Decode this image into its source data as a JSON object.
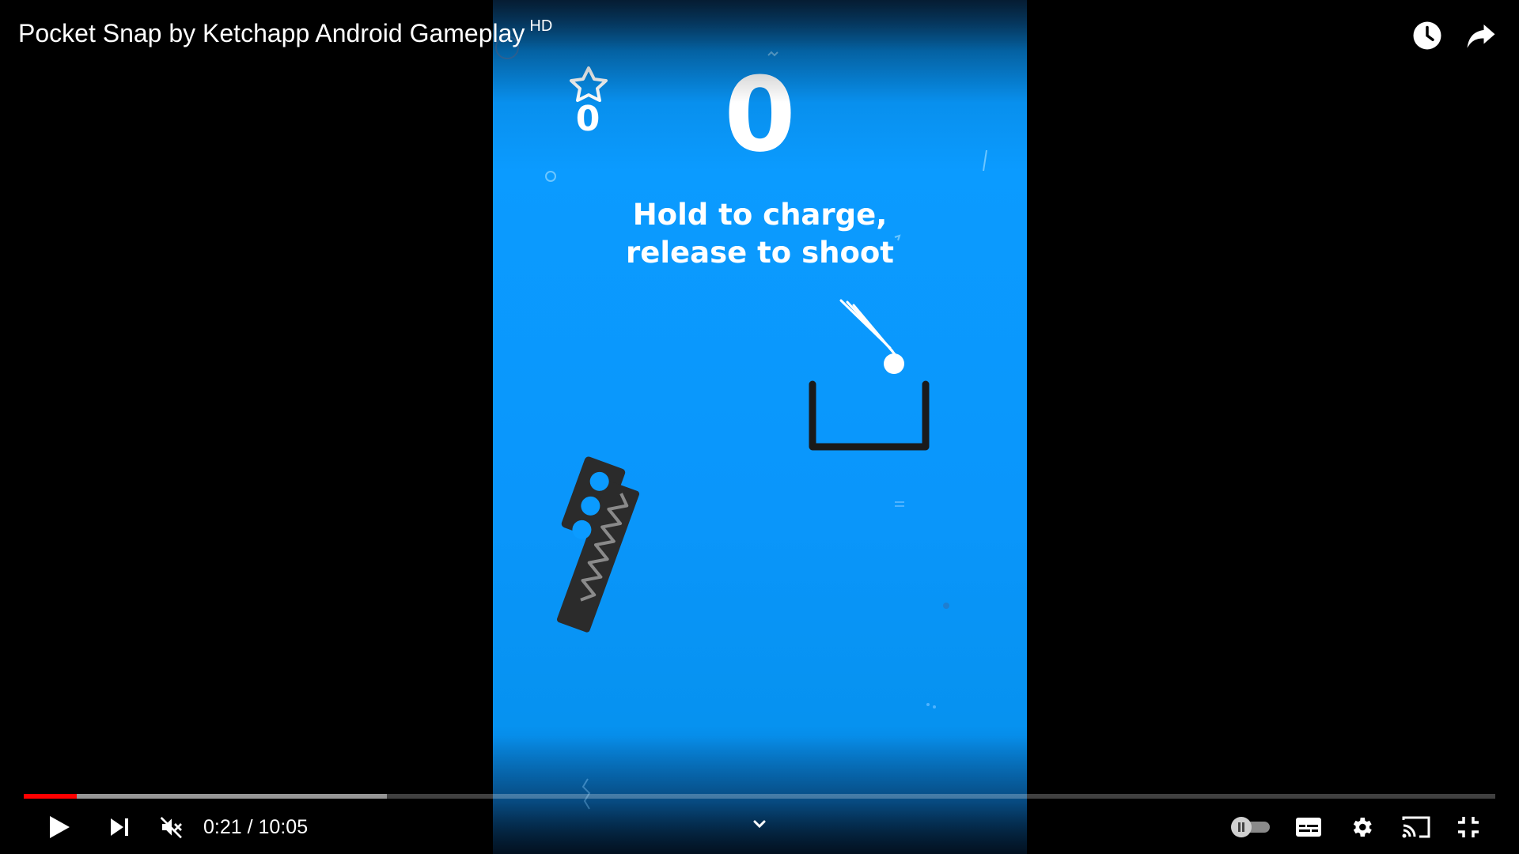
{
  "player": {
    "title": "Pocket Snap by Ketchapp Android Gameplay",
    "quality_badge": "HD",
    "current_time": "0:21",
    "separator": "/",
    "duration": "10:05",
    "played_fraction": 0.036,
    "buffered_fraction": 0.247,
    "muted": true,
    "autoplay": "off"
  },
  "game": {
    "score": "0",
    "stars": "0",
    "hint_line1": "Hold to charge,",
    "hint_line2": "release to shoot"
  },
  "colors": {
    "game_background": "#0b9bff",
    "progress_played": "#ff0000",
    "launcher": "#2b2b2b"
  },
  "icons": {
    "watch_later": "clock-icon",
    "share": "share-arrow-icon",
    "play": "play-icon",
    "next": "skip-next-icon",
    "volume": "volume-muted-icon",
    "autoplay": "autoplay-toggle-icon",
    "captions": "subtitles-icon",
    "settings": "gear-icon",
    "cast": "cast-icon",
    "exit_fullscreen": "exit-fullscreen-icon",
    "scroll": "chevron-down-icon"
  }
}
